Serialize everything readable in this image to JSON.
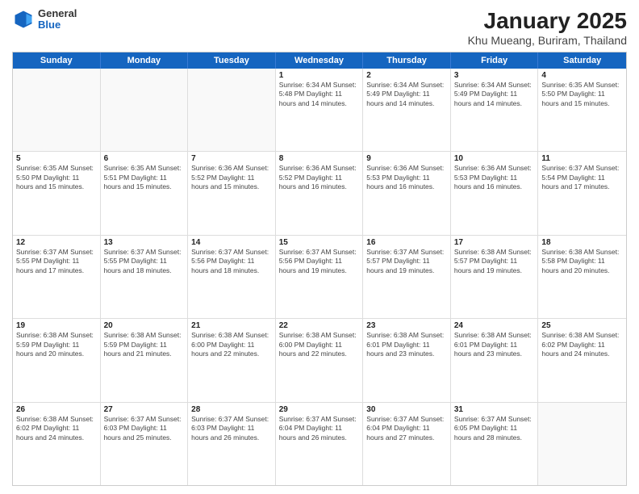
{
  "logo": {
    "general": "General",
    "blue": "Blue"
  },
  "title": "January 2025",
  "subtitle": "Khu Mueang, Buriram, Thailand",
  "days_of_week": [
    "Sunday",
    "Monday",
    "Tuesday",
    "Wednesday",
    "Thursday",
    "Friday",
    "Saturday"
  ],
  "weeks": [
    [
      {
        "day": "",
        "info": ""
      },
      {
        "day": "",
        "info": ""
      },
      {
        "day": "",
        "info": ""
      },
      {
        "day": "1",
        "info": "Sunrise: 6:34 AM\nSunset: 5:48 PM\nDaylight: 11 hours\nand 14 minutes."
      },
      {
        "day": "2",
        "info": "Sunrise: 6:34 AM\nSunset: 5:49 PM\nDaylight: 11 hours\nand 14 minutes."
      },
      {
        "day": "3",
        "info": "Sunrise: 6:34 AM\nSunset: 5:49 PM\nDaylight: 11 hours\nand 14 minutes."
      },
      {
        "day": "4",
        "info": "Sunrise: 6:35 AM\nSunset: 5:50 PM\nDaylight: 11 hours\nand 15 minutes."
      }
    ],
    [
      {
        "day": "5",
        "info": "Sunrise: 6:35 AM\nSunset: 5:50 PM\nDaylight: 11 hours\nand 15 minutes."
      },
      {
        "day": "6",
        "info": "Sunrise: 6:35 AM\nSunset: 5:51 PM\nDaylight: 11 hours\nand 15 minutes."
      },
      {
        "day": "7",
        "info": "Sunrise: 6:36 AM\nSunset: 5:52 PM\nDaylight: 11 hours\nand 15 minutes."
      },
      {
        "day": "8",
        "info": "Sunrise: 6:36 AM\nSunset: 5:52 PM\nDaylight: 11 hours\nand 16 minutes."
      },
      {
        "day": "9",
        "info": "Sunrise: 6:36 AM\nSunset: 5:53 PM\nDaylight: 11 hours\nand 16 minutes."
      },
      {
        "day": "10",
        "info": "Sunrise: 6:36 AM\nSunset: 5:53 PM\nDaylight: 11 hours\nand 16 minutes."
      },
      {
        "day": "11",
        "info": "Sunrise: 6:37 AM\nSunset: 5:54 PM\nDaylight: 11 hours\nand 17 minutes."
      }
    ],
    [
      {
        "day": "12",
        "info": "Sunrise: 6:37 AM\nSunset: 5:55 PM\nDaylight: 11 hours\nand 17 minutes."
      },
      {
        "day": "13",
        "info": "Sunrise: 6:37 AM\nSunset: 5:55 PM\nDaylight: 11 hours\nand 18 minutes."
      },
      {
        "day": "14",
        "info": "Sunrise: 6:37 AM\nSunset: 5:56 PM\nDaylight: 11 hours\nand 18 minutes."
      },
      {
        "day": "15",
        "info": "Sunrise: 6:37 AM\nSunset: 5:56 PM\nDaylight: 11 hours\nand 19 minutes."
      },
      {
        "day": "16",
        "info": "Sunrise: 6:37 AM\nSunset: 5:57 PM\nDaylight: 11 hours\nand 19 minutes."
      },
      {
        "day": "17",
        "info": "Sunrise: 6:38 AM\nSunset: 5:57 PM\nDaylight: 11 hours\nand 19 minutes."
      },
      {
        "day": "18",
        "info": "Sunrise: 6:38 AM\nSunset: 5:58 PM\nDaylight: 11 hours\nand 20 minutes."
      }
    ],
    [
      {
        "day": "19",
        "info": "Sunrise: 6:38 AM\nSunset: 5:59 PM\nDaylight: 11 hours\nand 20 minutes."
      },
      {
        "day": "20",
        "info": "Sunrise: 6:38 AM\nSunset: 5:59 PM\nDaylight: 11 hours\nand 21 minutes."
      },
      {
        "day": "21",
        "info": "Sunrise: 6:38 AM\nSunset: 6:00 PM\nDaylight: 11 hours\nand 22 minutes."
      },
      {
        "day": "22",
        "info": "Sunrise: 6:38 AM\nSunset: 6:00 PM\nDaylight: 11 hours\nand 22 minutes."
      },
      {
        "day": "23",
        "info": "Sunrise: 6:38 AM\nSunset: 6:01 PM\nDaylight: 11 hours\nand 23 minutes."
      },
      {
        "day": "24",
        "info": "Sunrise: 6:38 AM\nSunset: 6:01 PM\nDaylight: 11 hours\nand 23 minutes."
      },
      {
        "day": "25",
        "info": "Sunrise: 6:38 AM\nSunset: 6:02 PM\nDaylight: 11 hours\nand 24 minutes."
      }
    ],
    [
      {
        "day": "26",
        "info": "Sunrise: 6:38 AM\nSunset: 6:02 PM\nDaylight: 11 hours\nand 24 minutes."
      },
      {
        "day": "27",
        "info": "Sunrise: 6:37 AM\nSunset: 6:03 PM\nDaylight: 11 hours\nand 25 minutes."
      },
      {
        "day": "28",
        "info": "Sunrise: 6:37 AM\nSunset: 6:03 PM\nDaylight: 11 hours\nand 26 minutes."
      },
      {
        "day": "29",
        "info": "Sunrise: 6:37 AM\nSunset: 6:04 PM\nDaylight: 11 hours\nand 26 minutes."
      },
      {
        "day": "30",
        "info": "Sunrise: 6:37 AM\nSunset: 6:04 PM\nDaylight: 11 hours\nand 27 minutes."
      },
      {
        "day": "31",
        "info": "Sunrise: 6:37 AM\nSunset: 6:05 PM\nDaylight: 11 hours\nand 28 minutes."
      },
      {
        "day": "",
        "info": ""
      }
    ]
  ]
}
